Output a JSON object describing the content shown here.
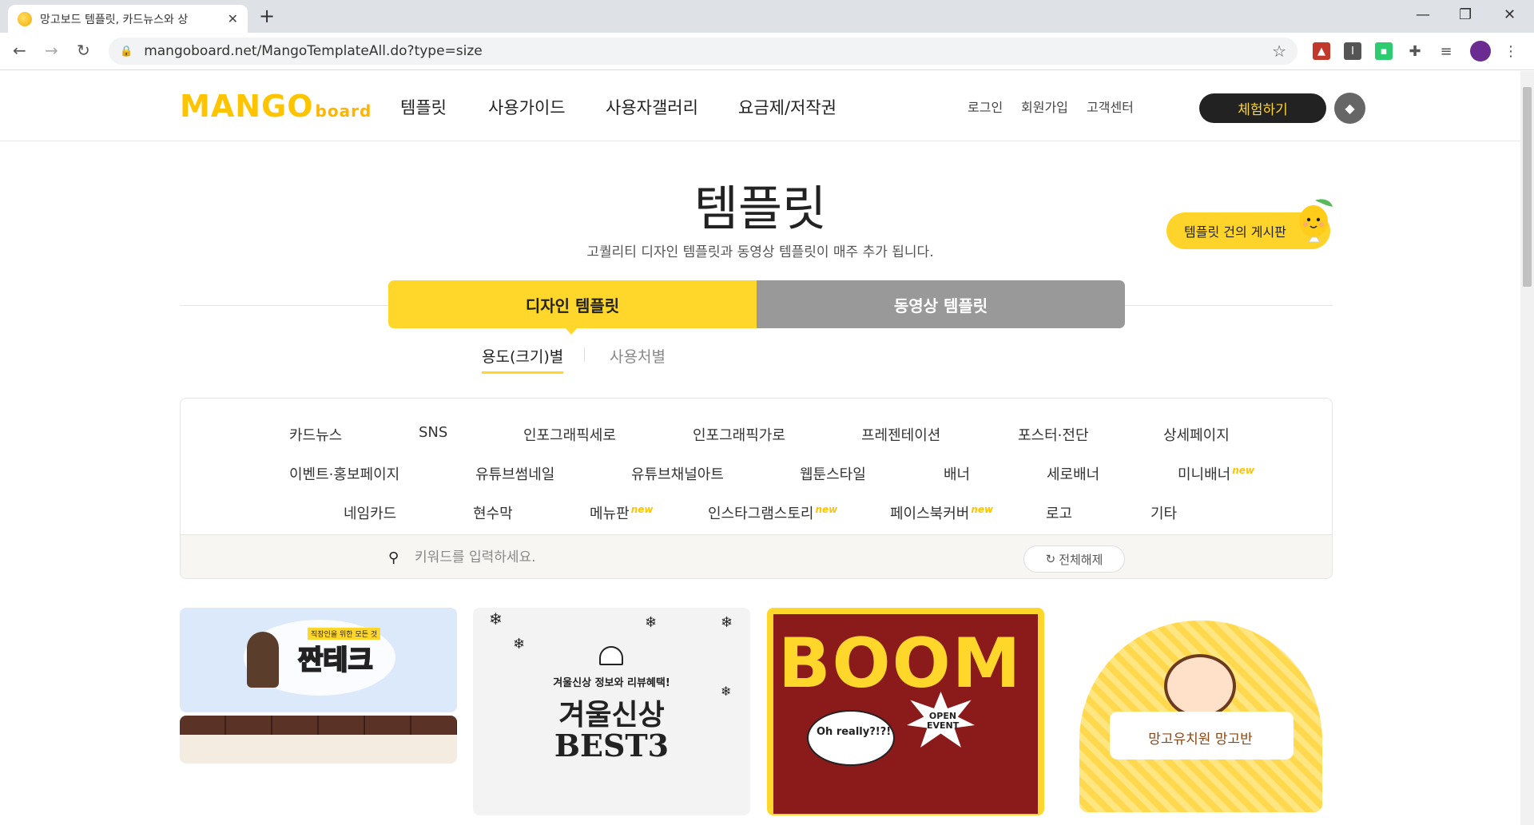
{
  "browser": {
    "tab_title": "망고보드 템플릿, 카드뉴스와 상",
    "url": "mangoboard.net/MangoTemplateAll.do?type=size"
  },
  "header": {
    "logo_main": "MANGO",
    "logo_sub": "board",
    "nav": [
      "템플릿",
      "사용가이드",
      "사용자갤러리",
      "요금제/저작권"
    ],
    "util": [
      "로그인",
      "회원가입",
      "고객센터"
    ],
    "try_button": "체험하기"
  },
  "hero": {
    "title": "템플릿",
    "subtitle": "고퀄리티 디자인 템플릿과 동영상 템플릿이 매주 추가 됩니다.",
    "suggest_button": "템플릿 건의 게시판"
  },
  "type_tabs": [
    "디자인 템플릿",
    "동영상 템플릿"
  ],
  "sub_tabs": [
    "용도(크기)별",
    "사용처별"
  ],
  "categories": {
    "row1": [
      "카드뉴스",
      "SNS",
      "인포그래픽세로",
      "인포그래픽가로",
      "프레젠테이션",
      "포스터·전단",
      "상세페이지"
    ],
    "row2": [
      "이벤트·홍보페이지",
      "유튜브썸네일",
      "유튜브채널아트",
      "웹툰스타일",
      "배너",
      "세로배너",
      "미니배너"
    ],
    "row3": [
      "네임카드",
      "현수막",
      "메뉴판",
      "인스타그램스토리",
      "페이스북커버",
      "로고",
      "기타"
    ],
    "new_badge": "new"
  },
  "search": {
    "placeholder": "키워드를 입력하세요.",
    "reset_label": "전체해제"
  },
  "thumbnails": {
    "card1_small": "직장인을 위한 모든 것",
    "card1_title": "짠테크",
    "card2_top": "겨울신상 정보와 리뷰혜택!",
    "card2_title": "겨울신상",
    "card2_sub": "BEST3",
    "card3_title": "BOOM",
    "card3_bubble": "Oh really?!?!",
    "card3_burst": "OPEN EVENT",
    "card4_title": "망고유치원 망고반"
  }
}
